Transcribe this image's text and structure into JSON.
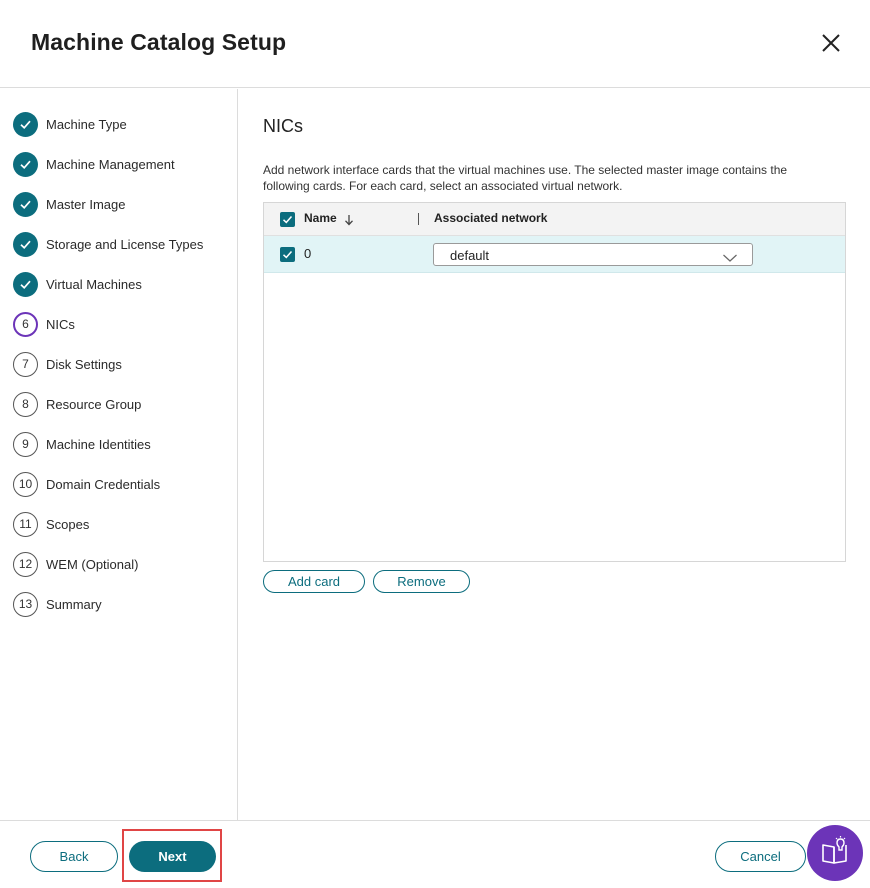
{
  "header": {
    "title": "Machine Catalog Setup"
  },
  "sidebar": {
    "steps": [
      {
        "label": "Machine Type",
        "status": "done"
      },
      {
        "label": "Machine Management",
        "status": "done"
      },
      {
        "label": "Master Image",
        "status": "done"
      },
      {
        "label": "Storage and License Types",
        "status": "done"
      },
      {
        "label": "Virtual Machines",
        "status": "done"
      },
      {
        "number": "6",
        "label": "NICs",
        "status": "current"
      },
      {
        "number": "7",
        "label": "Disk Settings",
        "status": "todo"
      },
      {
        "number": "8",
        "label": "Resource Group",
        "status": "todo"
      },
      {
        "number": "9",
        "label": "Machine Identities",
        "status": "todo"
      },
      {
        "number": "10",
        "label": "Domain Credentials",
        "status": "todo"
      },
      {
        "number": "11",
        "label": "Scopes",
        "status": "todo"
      },
      {
        "number": "12",
        "label": "WEM (Optional)",
        "status": "todo"
      },
      {
        "number": "13",
        "label": "Summary",
        "status": "todo"
      }
    ]
  },
  "main": {
    "title": "NICs",
    "description": "Add network interface cards that the virtual machines use. The selected master image contains the following cards. For each card, select an associated virtual network.",
    "table": {
      "columns": {
        "name": "Name",
        "network": "Associated network"
      },
      "rows": [
        {
          "name": "0",
          "network": "default"
        }
      ]
    },
    "add_card_label": "Add card",
    "remove_label": "Remove"
  },
  "footer": {
    "back_label": "Back",
    "next_label": "Next",
    "cancel_label": "Cancel"
  },
  "colors": {
    "accent": "#0c6d7e",
    "current_step": "#6c34b8",
    "row_selected": "#e1f4f6",
    "highlight": "#e04545"
  }
}
